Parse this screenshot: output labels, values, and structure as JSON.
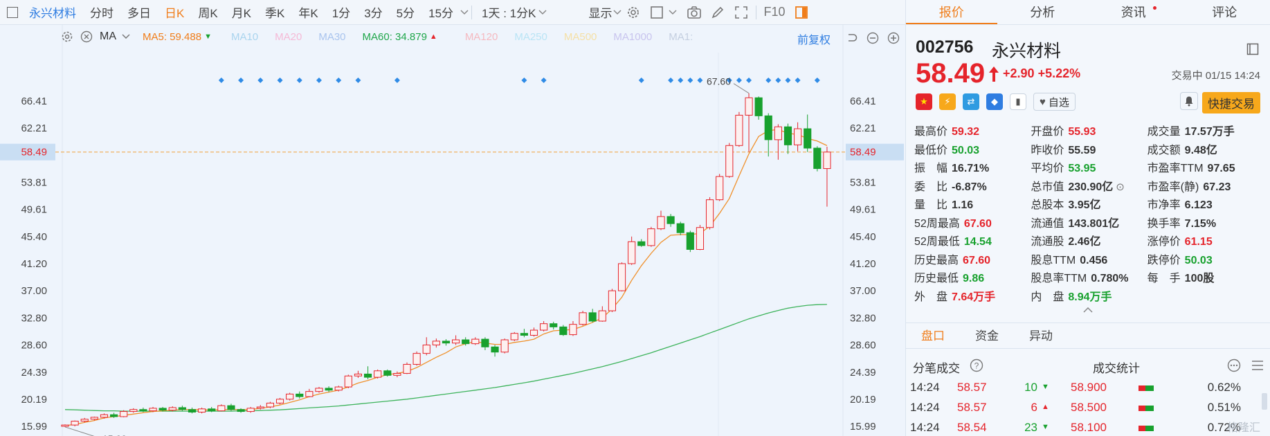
{
  "toolbar": {
    "stock_name": "永兴材料",
    "periods": [
      "分时",
      "多日",
      "日K",
      "周K",
      "月K",
      "季K",
      "年K",
      "1分",
      "3分",
      "5分",
      "15分"
    ],
    "active_period": "日K",
    "range": "1天 : 1分K",
    "display": "显示",
    "f10": "F10"
  },
  "ma_legend": {
    "ma": "MA",
    "items": [
      {
        "label": "MA5: 59.488",
        "color": "#f07d1a",
        "arrow": "down"
      },
      {
        "label": "MA10",
        "color": "#a9d4ee"
      },
      {
        "label": "MA20",
        "color": "#f5b9d6"
      },
      {
        "label": "MA30",
        "color": "#a9c4ee"
      },
      {
        "label": "MA60: 34.879",
        "color": "#1fa64a",
        "arrow": "up"
      },
      {
        "label": "MA120",
        "color": "#f5b9c0"
      },
      {
        "label": "MA250",
        "color": "#b9e4f5"
      },
      {
        "label": "MA500",
        "color": "#f5e0a6"
      },
      {
        "label": "MA1000",
        "color": "#c8c4ee"
      },
      {
        "label": "MA1:",
        "color": "#c4cfe0"
      }
    ],
    "adjust": "前复权"
  },
  "chart_data": {
    "type": "candlestick",
    "y_ticks": [
      "66.41",
      "62.21",
      "58.49",
      "53.81",
      "49.61",
      "45.40",
      "41.20",
      "37.00",
      "32.80",
      "28.60",
      "24.39",
      "20.19",
      "15.99"
    ],
    "current_price_label": "58.49",
    "high_label": "67.60",
    "low_label": "15.99",
    "ylim": [
      14.5,
      68
    ],
    "candles": [
      [
        16.0,
        16.2,
        15.9,
        16.3
      ],
      [
        16.2,
        16.8,
        15.99,
        16.9
      ],
      [
        16.8,
        17.1,
        16.6,
        17.3
      ],
      [
        17.1,
        17.4,
        16.9,
        17.5
      ],
      [
        17.4,
        17.8,
        17.2,
        18.0
      ],
      [
        17.8,
        17.5,
        17.3,
        18.1
      ],
      [
        17.5,
        18.3,
        17.4,
        18.5
      ],
      [
        18.3,
        18.6,
        18.1,
        18.8
      ],
      [
        18.6,
        18.4,
        18.2,
        18.9
      ],
      [
        18.4,
        18.8,
        18.2,
        19.0
      ],
      [
        18.8,
        18.5,
        18.3,
        19.0
      ],
      [
        18.5,
        18.9,
        18.3,
        19.1
      ],
      [
        18.9,
        18.6,
        18.4,
        19.2
      ],
      [
        18.6,
        18.2,
        18.0,
        18.9
      ],
      [
        18.2,
        18.7,
        18.0,
        18.9
      ],
      [
        18.7,
        18.4,
        18.2,
        19.0
      ],
      [
        18.4,
        19.2,
        18.3,
        19.4
      ],
      [
        19.2,
        18.6,
        18.4,
        19.5
      ],
      [
        18.6,
        18.3,
        18.1,
        18.8
      ],
      [
        18.3,
        18.8,
        18.1,
        19.0
      ],
      [
        18.8,
        19.0,
        18.6,
        19.3
      ],
      [
        19.0,
        19.6,
        18.8,
        19.8
      ],
      [
        19.6,
        20.2,
        19.4,
        20.4
      ],
      [
        20.2,
        21.0,
        20.0,
        21.2
      ],
      [
        21.0,
        20.6,
        20.3,
        21.4
      ],
      [
        20.6,
        21.4,
        20.5,
        21.8
      ],
      [
        21.4,
        21.9,
        21.2,
        22.1
      ],
      [
        21.9,
        21.6,
        21.3,
        22.2
      ],
      [
        21.6,
        22.1,
        21.4,
        22.3
      ],
      [
        22.1,
        23.8,
        21.9,
        24.0
      ],
      [
        23.8,
        24.1,
        23.5,
        24.6
      ],
      [
        24.1,
        23.6,
        23.3,
        25.3
      ],
      [
        23.6,
        24.6,
        23.4,
        24.8
      ],
      [
        24.6,
        23.9,
        23.7,
        24.8
      ],
      [
        23.9,
        24.2,
        23.6,
        24.5
      ],
      [
        24.2,
        25.6,
        24.1,
        25.9
      ],
      [
        25.6,
        27.3,
        25.4,
        27.6
      ],
      [
        27.3,
        28.6,
        27.0,
        29.8
      ],
      [
        28.6,
        29.2,
        28.2,
        29.6
      ],
      [
        29.2,
        28.9,
        28.5,
        29.5
      ],
      [
        28.9,
        29.4,
        28.6,
        30.1
      ],
      [
        29.4,
        28.8,
        28.5,
        29.8
      ],
      [
        28.8,
        29.5,
        28.6,
        29.8
      ],
      [
        29.5,
        28.3,
        27.8,
        29.8
      ],
      [
        28.3,
        27.5,
        26.8,
        28.6
      ],
      [
        27.5,
        29.4,
        27.3,
        29.6
      ],
      [
        29.4,
        30.4,
        29.2,
        30.6
      ],
      [
        30.4,
        30.1,
        29.8,
        31.1
      ],
      [
        30.1,
        30.9,
        29.9,
        31.3
      ],
      [
        30.9,
        31.9,
        30.7,
        32.3
      ],
      [
        31.9,
        31.4,
        31.0,
        32.2
      ],
      [
        31.4,
        30.2,
        30.0,
        31.7
      ],
      [
        30.2,
        31.8,
        30.0,
        32.3
      ],
      [
        31.8,
        33.6,
        31.6,
        33.9
      ],
      [
        33.6,
        32.3,
        32.1,
        34.2
      ],
      [
        32.3,
        33.9,
        32.2,
        34.6
      ],
      [
        33.9,
        37.0,
        33.7,
        37.3
      ],
      [
        37.0,
        41.2,
        36.9,
        41.4
      ],
      [
        41.2,
        44.6,
        41.0,
        45.4
      ],
      [
        44.6,
        44.0,
        43.8,
        45.0
      ],
      [
        44.0,
        46.6,
        43.8,
        46.9
      ],
      [
        46.6,
        48.5,
        46.4,
        49.4
      ],
      [
        48.5,
        47.4,
        46.9,
        48.9
      ],
      [
        47.4,
        46.0,
        45.6,
        47.7
      ],
      [
        46.0,
        43.4,
        43.0,
        46.3
      ],
      [
        43.4,
        46.8,
        43.3,
        47.2
      ],
      [
        46.8,
        51.1,
        46.5,
        51.5
      ],
      [
        51.1,
        54.7,
        50.9,
        55.1
      ],
      [
        54.7,
        59.5,
        54.5,
        59.9
      ],
      [
        59.5,
        64.2,
        59.3,
        64.7
      ],
      [
        64.2,
        66.9,
        58.5,
        67.6
      ],
      [
        66.9,
        64.1,
        63.5,
        67.1
      ],
      [
        64.1,
        60.4,
        57.8,
        64.5
      ],
      [
        60.4,
        62.4,
        57.3,
        62.8
      ],
      [
        62.4,
        59.6,
        58.2,
        62.9
      ],
      [
        59.6,
        62.1,
        58.6,
        63.1
      ],
      [
        62.1,
        59.1,
        58.5,
        64.3
      ],
      [
        59.1,
        55.93,
        55.5,
        59.4
      ],
      [
        55.93,
        58.49,
        50.03,
        59.32
      ]
    ],
    "ma5": [
      16.1,
      16.3,
      16.6,
      16.9,
      17.3,
      17.5,
      17.7,
      17.9,
      18.1,
      18.3,
      18.4,
      18.5,
      18.6,
      18.6,
      18.6,
      18.5,
      18.6,
      18.6,
      18.6,
      18.6,
      18.8,
      19.0,
      19.3,
      19.7,
      20.1,
      20.6,
      21.0,
      21.3,
      21.6,
      22.1,
      22.7,
      23.1,
      23.6,
      24.0,
      24.2,
      24.5,
      25.1,
      25.9,
      26.7,
      27.4,
      28.3,
      28.8,
      29.1,
      28.9,
      28.7,
      28.7,
      29.0,
      29.2,
      29.5,
      30.3,
      30.8,
      30.9,
      31.0,
      31.5,
      32.1,
      32.8,
      34.2,
      36.0,
      38.6,
      40.9,
      42.8,
      44.5,
      45.6,
      45.7,
      45.7,
      45.9,
      47.0,
      49.0,
      51.3,
      54.8,
      58.2,
      60.9,
      61.8,
      62.0,
      61.4,
      61.2,
      60.6,
      60.2,
      59.488
    ],
    "ma60": [
      18.6,
      18.55,
      18.5,
      18.45,
      18.4,
      18.4,
      18.35,
      18.35,
      18.35,
      18.35,
      18.35,
      18.35,
      18.35,
      18.35,
      18.35,
      18.35,
      18.35,
      18.35,
      18.4,
      18.4,
      18.45,
      18.5,
      18.55,
      18.65,
      18.75,
      18.85,
      18.95,
      19.05,
      19.15,
      19.3,
      19.45,
      19.6,
      19.75,
      19.9,
      20.05,
      20.2,
      20.4,
      20.6,
      20.8,
      21.0,
      21.2,
      21.4,
      21.6,
      21.8,
      22.0,
      22.25,
      22.5,
      22.75,
      23.0,
      23.3,
      23.6,
      23.9,
      24.2,
      24.55,
      24.9,
      25.25,
      25.65,
      26.05,
      26.5,
      26.95,
      27.4,
      27.9,
      28.4,
      28.9,
      29.4,
      29.9,
      30.45,
      31.0,
      31.55,
      32.1,
      32.65,
      33.1,
      33.55,
      33.95,
      34.3,
      34.55,
      34.75,
      34.85,
      34.879
    ]
  },
  "panel": {
    "tabs": [
      "报价",
      "分析",
      "资讯",
      "评论"
    ],
    "active_tab": "报价",
    "code": "002756",
    "name": "永兴材料",
    "price": "58.49",
    "change": "+2.90",
    "change_pct": "+5.22%",
    "trading_status": "交易中 01/15 14:24",
    "watchlist": "自选",
    "quick_trade": "快捷交易",
    "stats": [
      [
        {
          "l": "最高价",
          "v": "59.32",
          "c": "red"
        },
        {
          "l": "开盘价",
          "v": "55.93",
          "c": "red"
        },
        {
          "l": "成交量",
          "v": "17.57万手",
          "c": "dark"
        }
      ],
      [
        {
          "l": "最低价",
          "v": "50.03",
          "c": "green"
        },
        {
          "l": "昨收价",
          "v": "55.59",
          "c": "dark"
        },
        {
          "l": "成交额",
          "v": "9.48亿",
          "c": "dark"
        }
      ],
      [
        {
          "l": "振　幅",
          "v": "16.71%",
          "c": "dark"
        },
        {
          "l": "平均价",
          "v": "53.95",
          "c": "green"
        },
        {
          "l": "市盈率TTM",
          "v": "97.65",
          "c": "dark"
        }
      ],
      [
        {
          "l": "委　比",
          "v": "-6.87%",
          "c": "dark"
        },
        {
          "l": "总市值",
          "v": "230.90亿",
          "c": "dark"
        },
        {
          "l": "市盈率(静)",
          "v": "67.23",
          "c": "dark"
        }
      ],
      [
        {
          "l": "量　比",
          "v": "1.16",
          "c": "dark"
        },
        {
          "l": "总股本",
          "v": "3.95亿",
          "c": "dark"
        },
        {
          "l": "市净率",
          "v": "6.123",
          "c": "dark"
        }
      ],
      [
        {
          "l": "52周最高",
          "v": "67.60",
          "c": "red"
        },
        {
          "l": "流通值",
          "v": "143.801亿",
          "c": "dark"
        },
        {
          "l": "换手率",
          "v": "7.15%",
          "c": "dark"
        }
      ],
      [
        {
          "l": "52周最低",
          "v": "14.54",
          "c": "green"
        },
        {
          "l": "流通股",
          "v": "2.46亿",
          "c": "dark"
        },
        {
          "l": "涨停价",
          "v": "61.15",
          "c": "red"
        }
      ],
      [
        {
          "l": "历史最高",
          "v": "67.60",
          "c": "red"
        },
        {
          "l": "股息TTM",
          "v": "0.456",
          "c": "dark"
        },
        {
          "l": "跌停价",
          "v": "50.03",
          "c": "green"
        }
      ],
      [
        {
          "l": "历史最低",
          "v": "9.86",
          "c": "green"
        },
        {
          "l": "股息率TTM",
          "v": "0.780%",
          "c": "dark"
        },
        {
          "l": "每　手",
          "v": "100股",
          "c": "dark"
        }
      ],
      [
        {
          "l": "外　盘",
          "v": "7.64万手",
          "c": "red"
        },
        {
          "l": "内　盘",
          "v": "8.94万手",
          "c": "green"
        },
        {
          "l": "",
          "v": "",
          "c": "dark"
        }
      ]
    ],
    "sub_tabs": [
      "盘口",
      "资金",
      "异动"
    ],
    "active_sub_tab": "盘口",
    "ticks_title": "分笔成交",
    "stats_title": "成交统计",
    "ticks": [
      {
        "time": "14:24",
        "price": "58.57",
        "vol": "10",
        "dir": "down"
      },
      {
        "time": "14:24",
        "price": "58.57",
        "vol": "6",
        "dir": "up"
      },
      {
        "time": "14:24",
        "price": "58.54",
        "vol": "23",
        "dir": "down"
      }
    ],
    "dist": [
      {
        "price": "58.900",
        "pct": "0.62%"
      },
      {
        "price": "58.500",
        "pct": "0.51%"
      },
      {
        "price": "58.100",
        "pct": "0.72%"
      }
    ],
    "watermark": "格隆汇"
  }
}
